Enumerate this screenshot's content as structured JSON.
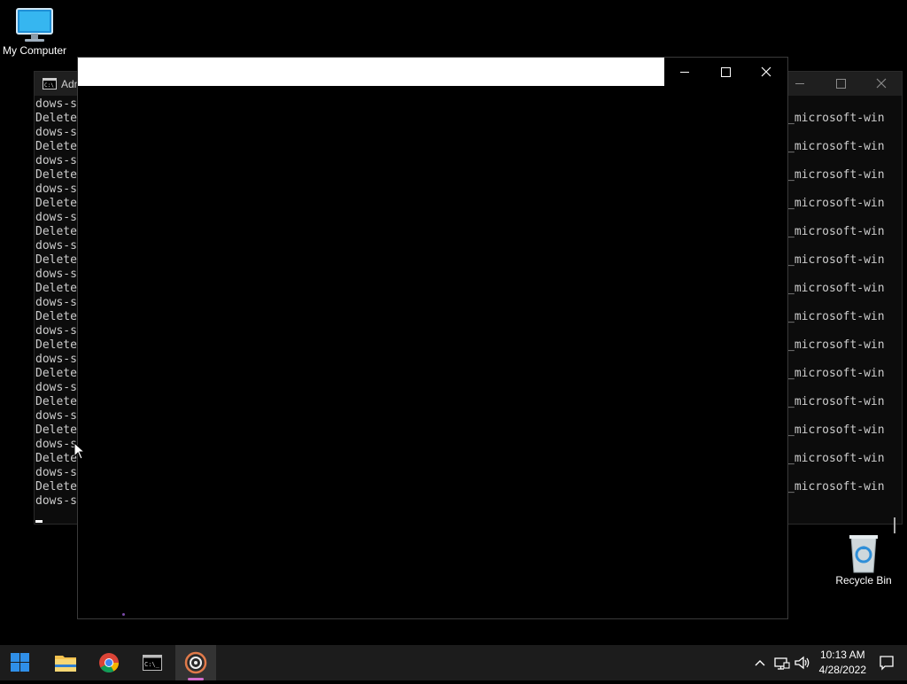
{
  "desktop": {
    "icons": [
      {
        "label": "My Computer",
        "icon": "monitor-icon"
      },
      {
        "label": "Recycle Bin",
        "icon": "recycle-bin-icon"
      }
    ]
  },
  "console_window": {
    "left_lines": [
      "dows-s",
      "Delete",
      "dows-s",
      "Delete",
      "dows-s",
      "Delete",
      "dows-s",
      "Delete",
      "dows-s",
      "Delete",
      "dows-s",
      "Delete",
      "dows-s",
      "Delete",
      "dows-s",
      "Delete",
      "dows-s",
      "Delete",
      "dows-s",
      "Delete",
      "dows-s",
      "Delete",
      "dows-s",
      "Delete",
      "dows-s",
      "Delete",
      "dows-s",
      "Delete",
      "dows-s"
    ],
    "right_lines": [
      "_microsoft-win",
      "_microsoft-win",
      "_microsoft-win",
      "_microsoft-win",
      "_microsoft-win",
      "_microsoft-win",
      "_microsoft-win",
      "_microsoft-win",
      "_microsoft-win",
      "_microsoft-win",
      "_microsoft-win",
      "_microsoft-win",
      "_microsoft-win",
      "_microsoft-win"
    ],
    "title_text": "Adm",
    "controls": [
      "minimize-icon",
      "maximize-icon",
      "close-icon"
    ]
  },
  "front_window": {
    "controls": [
      "minimize-icon",
      "maximize-icon",
      "close-icon"
    ]
  },
  "taskbar": {
    "apps": [
      {
        "name": "start",
        "icon": "windows-logo-icon"
      },
      {
        "name": "file-explorer",
        "icon": "folder-icon"
      },
      {
        "name": "chrome",
        "icon": "chrome-icon"
      },
      {
        "name": "command-prompt",
        "icon": "terminal-icon"
      },
      {
        "name": "media-app",
        "icon": "disc-icon",
        "active": true
      }
    ],
    "tray": {
      "time": "10:13 AM",
      "date": "4/28/2022"
    }
  },
  "colors": {
    "taskbar_bg": "#1c1c1c",
    "active_underline": "#cf6bc9",
    "console_text": "#cccccc"
  }
}
